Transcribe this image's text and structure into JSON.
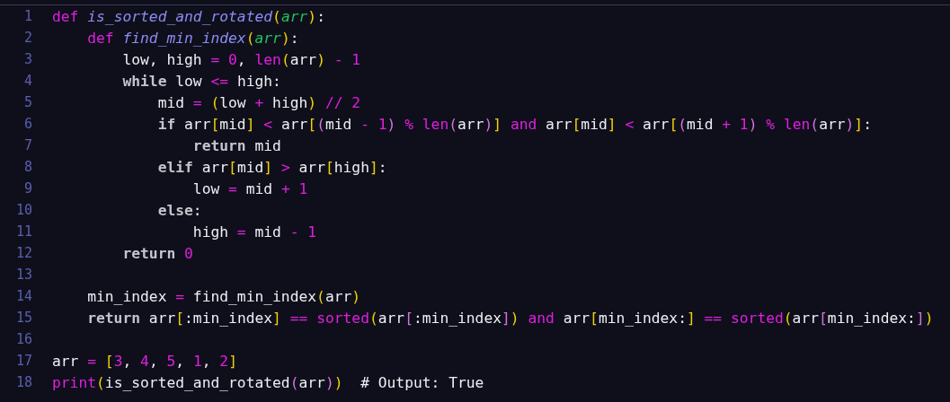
{
  "editor": {
    "lines": [
      {
        "number": "1",
        "tokens": [
          {
            "kind": "kw",
            "text": "def"
          },
          {
            "kind": "def",
            "text": " is_sorted_and_rotated"
          },
          {
            "kind": "br1",
            "text": "("
          },
          {
            "kind": "param",
            "text": "arr"
          },
          {
            "kind": "br1",
            "text": ")"
          },
          {
            "kind": "plain",
            "text": ":"
          }
        ]
      },
      {
        "number": "2",
        "tokens": [
          {
            "kind": "kw",
            "text": "    def"
          },
          {
            "kind": "def",
            "text": " find_min_index"
          },
          {
            "kind": "br1",
            "text": "("
          },
          {
            "kind": "param",
            "text": "arr"
          },
          {
            "kind": "br1",
            "text": ")"
          },
          {
            "kind": "plain",
            "text": ":"
          }
        ]
      },
      {
        "number": "3",
        "tokens": [
          {
            "kind": "plain",
            "text": "        low, high"
          },
          {
            "kind": "op",
            "text": " ="
          },
          {
            "kind": "num",
            "text": " 0"
          },
          {
            "kind": "plain",
            "text": ","
          },
          {
            "kind": "call",
            "text": " len"
          },
          {
            "kind": "br1",
            "text": "("
          },
          {
            "kind": "plain",
            "text": "arr"
          },
          {
            "kind": "br1",
            "text": ")"
          },
          {
            "kind": "op",
            "text": " -"
          },
          {
            "kind": "num",
            "text": " 1"
          }
        ]
      },
      {
        "number": "4",
        "tokens": [
          {
            "kind": "ctrl",
            "text": "        while"
          },
          {
            "kind": "plain",
            "text": " low"
          },
          {
            "kind": "op",
            "text": " <="
          },
          {
            "kind": "plain",
            "text": " high:"
          }
        ]
      },
      {
        "number": "5",
        "tokens": [
          {
            "kind": "plain",
            "text": "            mid"
          },
          {
            "kind": "op",
            "text": " ="
          },
          {
            "kind": "br1",
            "text": " ("
          },
          {
            "kind": "plain",
            "text": "low"
          },
          {
            "kind": "op",
            "text": " +"
          },
          {
            "kind": "plain",
            "text": " high"
          },
          {
            "kind": "br1",
            "text": ")"
          },
          {
            "kind": "op",
            "text": " //"
          },
          {
            "kind": "num",
            "text": " 2"
          }
        ]
      },
      {
        "number": "6",
        "tokens": [
          {
            "kind": "ctrl",
            "text": "            if"
          },
          {
            "kind": "plain",
            "text": " arr"
          },
          {
            "kind": "br1",
            "text": "["
          },
          {
            "kind": "plain",
            "text": "mid"
          },
          {
            "kind": "br1",
            "text": "]"
          },
          {
            "kind": "op",
            "text": " <"
          },
          {
            "kind": "plain",
            "text": " arr"
          },
          {
            "kind": "br1",
            "text": "["
          },
          {
            "kind": "br2",
            "text": "("
          },
          {
            "kind": "plain",
            "text": "mid"
          },
          {
            "kind": "op",
            "text": " -"
          },
          {
            "kind": "num",
            "text": " 1"
          },
          {
            "kind": "br2",
            "text": ")"
          },
          {
            "kind": "op",
            "text": " %"
          },
          {
            "kind": "call",
            "text": " len"
          },
          {
            "kind": "br2",
            "text": "("
          },
          {
            "kind": "plain",
            "text": "arr"
          },
          {
            "kind": "br2",
            "text": ")"
          },
          {
            "kind": "br1",
            "text": "]"
          },
          {
            "kind": "kw",
            "text": " and"
          },
          {
            "kind": "plain",
            "text": " arr"
          },
          {
            "kind": "br1",
            "text": "["
          },
          {
            "kind": "plain",
            "text": "mid"
          },
          {
            "kind": "br1",
            "text": "]"
          },
          {
            "kind": "op",
            "text": " <"
          },
          {
            "kind": "plain",
            "text": " arr"
          },
          {
            "kind": "br1",
            "text": "["
          },
          {
            "kind": "br2",
            "text": "("
          },
          {
            "kind": "plain",
            "text": "mid"
          },
          {
            "kind": "op",
            "text": " +"
          },
          {
            "kind": "num",
            "text": " 1"
          },
          {
            "kind": "br2",
            "text": ")"
          },
          {
            "kind": "op",
            "text": " %"
          },
          {
            "kind": "call",
            "text": " len"
          },
          {
            "kind": "br2",
            "text": "("
          },
          {
            "kind": "plain",
            "text": "arr"
          },
          {
            "kind": "br2",
            "text": ")"
          },
          {
            "kind": "br1",
            "text": "]"
          },
          {
            "kind": "plain",
            "text": ":"
          }
        ]
      },
      {
        "number": "7",
        "tokens": [
          {
            "kind": "ctrl",
            "text": "                return"
          },
          {
            "kind": "plain",
            "text": " mid"
          }
        ]
      },
      {
        "number": "8",
        "tokens": [
          {
            "kind": "ctrl",
            "text": "            elif"
          },
          {
            "kind": "plain",
            "text": " arr"
          },
          {
            "kind": "br1",
            "text": "["
          },
          {
            "kind": "plain",
            "text": "mid"
          },
          {
            "kind": "br1",
            "text": "]"
          },
          {
            "kind": "op",
            "text": " >"
          },
          {
            "kind": "plain",
            "text": " arr"
          },
          {
            "kind": "br1",
            "text": "["
          },
          {
            "kind": "plain",
            "text": "high"
          },
          {
            "kind": "br1",
            "text": "]"
          },
          {
            "kind": "plain",
            "text": ":"
          }
        ]
      },
      {
        "number": "9",
        "tokens": [
          {
            "kind": "plain",
            "text": "                low"
          },
          {
            "kind": "op",
            "text": " ="
          },
          {
            "kind": "plain",
            "text": " mid"
          },
          {
            "kind": "op",
            "text": " +"
          },
          {
            "kind": "num",
            "text": " 1"
          }
        ]
      },
      {
        "number": "10",
        "tokens": [
          {
            "kind": "ctrl",
            "text": "            else"
          },
          {
            "kind": "plain",
            "text": ":"
          }
        ]
      },
      {
        "number": "11",
        "tokens": [
          {
            "kind": "plain",
            "text": "                high"
          },
          {
            "kind": "op",
            "text": " ="
          },
          {
            "kind": "plain",
            "text": " mid"
          },
          {
            "kind": "op",
            "text": " -"
          },
          {
            "kind": "num",
            "text": " 1"
          }
        ]
      },
      {
        "number": "12",
        "tokens": [
          {
            "kind": "ctrl",
            "text": "        return"
          },
          {
            "kind": "num",
            "text": " 0"
          }
        ]
      },
      {
        "number": "13"
      },
      {
        "number": "14",
        "tokens": [
          {
            "kind": "plain",
            "text": "    min_index"
          },
          {
            "kind": "op",
            "text": " ="
          },
          {
            "kind": "plain",
            "text": " find_min_index"
          },
          {
            "kind": "br1",
            "text": "("
          },
          {
            "kind": "plain",
            "text": "arr"
          },
          {
            "kind": "br1",
            "text": ")"
          }
        ]
      },
      {
        "number": "15",
        "tokens": [
          {
            "kind": "ctrl",
            "text": "    return"
          },
          {
            "kind": "plain",
            "text": " arr"
          },
          {
            "kind": "br1",
            "text": "["
          },
          {
            "kind": "plain",
            "text": ":min_index"
          },
          {
            "kind": "br1",
            "text": "]"
          },
          {
            "kind": "op",
            "text": " =="
          },
          {
            "kind": "call",
            "text": " sorted"
          },
          {
            "kind": "br1",
            "text": "("
          },
          {
            "kind": "plain",
            "text": "arr"
          },
          {
            "kind": "br2",
            "text": "["
          },
          {
            "kind": "plain",
            "text": ":min_index"
          },
          {
            "kind": "br2",
            "text": "]"
          },
          {
            "kind": "br1",
            "text": ")"
          },
          {
            "kind": "kw",
            "text": " and"
          },
          {
            "kind": "plain",
            "text": " arr"
          },
          {
            "kind": "br1",
            "text": "["
          },
          {
            "kind": "plain",
            "text": "min_index:"
          },
          {
            "kind": "br1",
            "text": "]"
          },
          {
            "kind": "op",
            "text": " =="
          },
          {
            "kind": "call",
            "text": " sorted"
          },
          {
            "kind": "br1",
            "text": "("
          },
          {
            "kind": "plain",
            "text": "arr"
          },
          {
            "kind": "br2",
            "text": "["
          },
          {
            "kind": "plain",
            "text": "min_index:"
          },
          {
            "kind": "br2",
            "text": "]"
          },
          {
            "kind": "br1",
            "text": ")"
          }
        ]
      },
      {
        "number": "16"
      },
      {
        "number": "17",
        "tokens": [
          {
            "kind": "plain",
            "text": "arr"
          },
          {
            "kind": "op",
            "text": " ="
          },
          {
            "kind": "br1",
            "text": " ["
          },
          {
            "kind": "num",
            "text": "3"
          },
          {
            "kind": "plain",
            "text": ","
          },
          {
            "kind": "num",
            "text": " 4"
          },
          {
            "kind": "plain",
            "text": ","
          },
          {
            "kind": "num",
            "text": " 5"
          },
          {
            "kind": "plain",
            "text": ","
          },
          {
            "kind": "num",
            "text": " 1"
          },
          {
            "kind": "plain",
            "text": ","
          },
          {
            "kind": "num",
            "text": " 2"
          },
          {
            "kind": "br1",
            "text": "]"
          }
        ]
      },
      {
        "number": "18",
        "tokens": [
          {
            "kind": "call",
            "text": "print"
          },
          {
            "kind": "br1",
            "text": "("
          },
          {
            "kind": "plain",
            "text": "is_sorted_and_rotated"
          },
          {
            "kind": "br2",
            "text": "("
          },
          {
            "kind": "plain",
            "text": "arr"
          },
          {
            "kind": "br2",
            "text": ")"
          },
          {
            "kind": "br1",
            "text": ")"
          },
          {
            "kind": "comment",
            "text": "  # Output: True"
          }
        ]
      }
    ]
  }
}
